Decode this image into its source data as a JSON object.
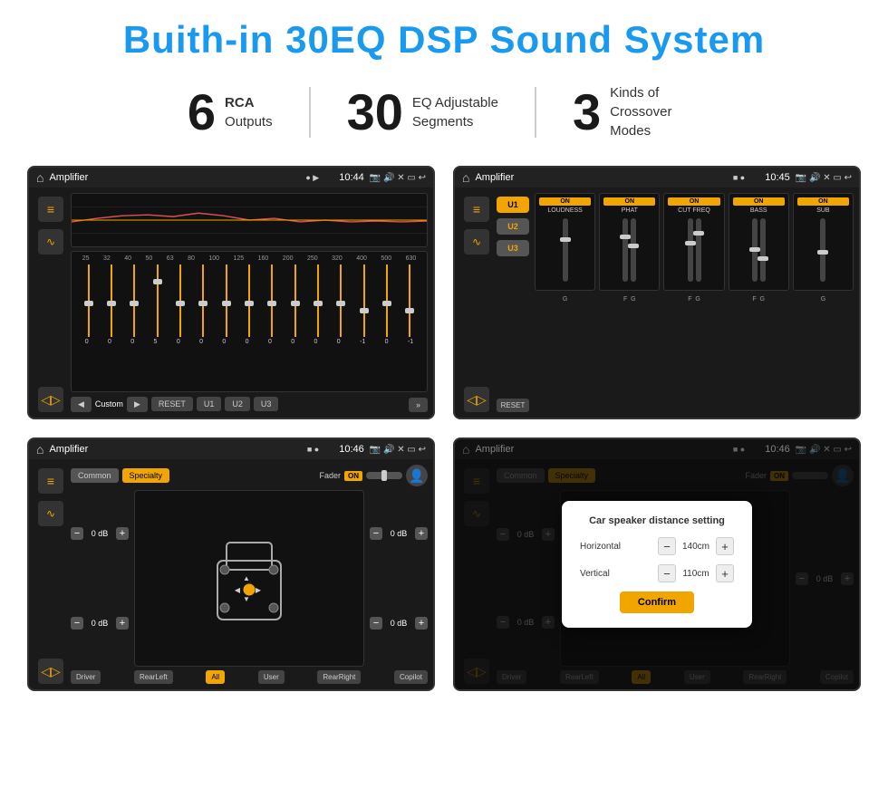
{
  "page": {
    "title": "Buith-in 30EQ DSP Sound System",
    "stats": [
      {
        "number": "6",
        "label_line1": "RCA",
        "label_line2": "Outputs"
      },
      {
        "number": "30",
        "label_line1": "EQ Adjustable",
        "label_line2": "Segments"
      },
      {
        "number": "3",
        "label_line1": "Kinds of",
        "label_line2": "Crossover Modes"
      }
    ]
  },
  "screens": {
    "eq": {
      "title": "Amplifier",
      "time": "10:44",
      "freq_labels": [
        "25",
        "32",
        "40",
        "50",
        "63",
        "80",
        "100",
        "125",
        "160",
        "200",
        "250",
        "320",
        "400",
        "500",
        "630"
      ],
      "slider_values": [
        "0",
        "0",
        "0",
        "5",
        "0",
        "0",
        "0",
        "0",
        "0",
        "0",
        "0",
        "0",
        "-1",
        "0",
        "-1"
      ],
      "preset_label": "Custom",
      "buttons": [
        "RESET",
        "U1",
        "U2",
        "U3"
      ]
    },
    "crossover": {
      "title": "Amplifier",
      "time": "10:45",
      "presets": [
        "U1",
        "U2",
        "U3"
      ],
      "modules": [
        {
          "on": true,
          "label": "LOUDNESS"
        },
        {
          "on": true,
          "label": "PHAT"
        },
        {
          "on": true,
          "label": "CUT FREQ"
        },
        {
          "on": true,
          "label": "BASS"
        },
        {
          "on": true,
          "label": "SUB"
        }
      ],
      "reset_label": "RESET"
    },
    "fader": {
      "title": "Amplifier",
      "time": "10:46",
      "tabs": [
        "Common",
        "Specialty"
      ],
      "fader_label": "Fader",
      "fader_on": "ON",
      "volume_rows": [
        {
          "value": "0 dB"
        },
        {
          "value": "0 dB"
        },
        {
          "value": "0 dB"
        },
        {
          "value": "0 dB"
        }
      ],
      "bottom_buttons": [
        "Driver",
        "RearLeft",
        "All",
        "User",
        "RearRight",
        "Copilot"
      ]
    },
    "distance": {
      "title": "Amplifier",
      "time": "10:46",
      "tabs": [
        "Common",
        "Specialty"
      ],
      "dialog": {
        "title": "Car speaker distance setting",
        "horizontal_label": "Horizontal",
        "horizontal_value": "140cm",
        "vertical_label": "Vertical",
        "vertical_value": "110cm",
        "confirm_label": "Confirm"
      },
      "volume_rows": [
        {
          "value": "0 dB"
        },
        {
          "value": "0 dB"
        }
      ],
      "bottom_buttons": [
        "Driver",
        "RearLeft",
        "All",
        "User",
        "RearRight",
        "Copilot"
      ]
    }
  },
  "icons": {
    "home": "⌂",
    "back": "↩",
    "eq_icon": "≡",
    "wave_icon": "∿",
    "speaker_icon": "⊿",
    "person_icon": "👤",
    "location": "📍",
    "camera": "📷",
    "volume": "🔊",
    "cross": "✕",
    "minus": "▭",
    "minus_sym": "−",
    "plus_sym": "+"
  }
}
